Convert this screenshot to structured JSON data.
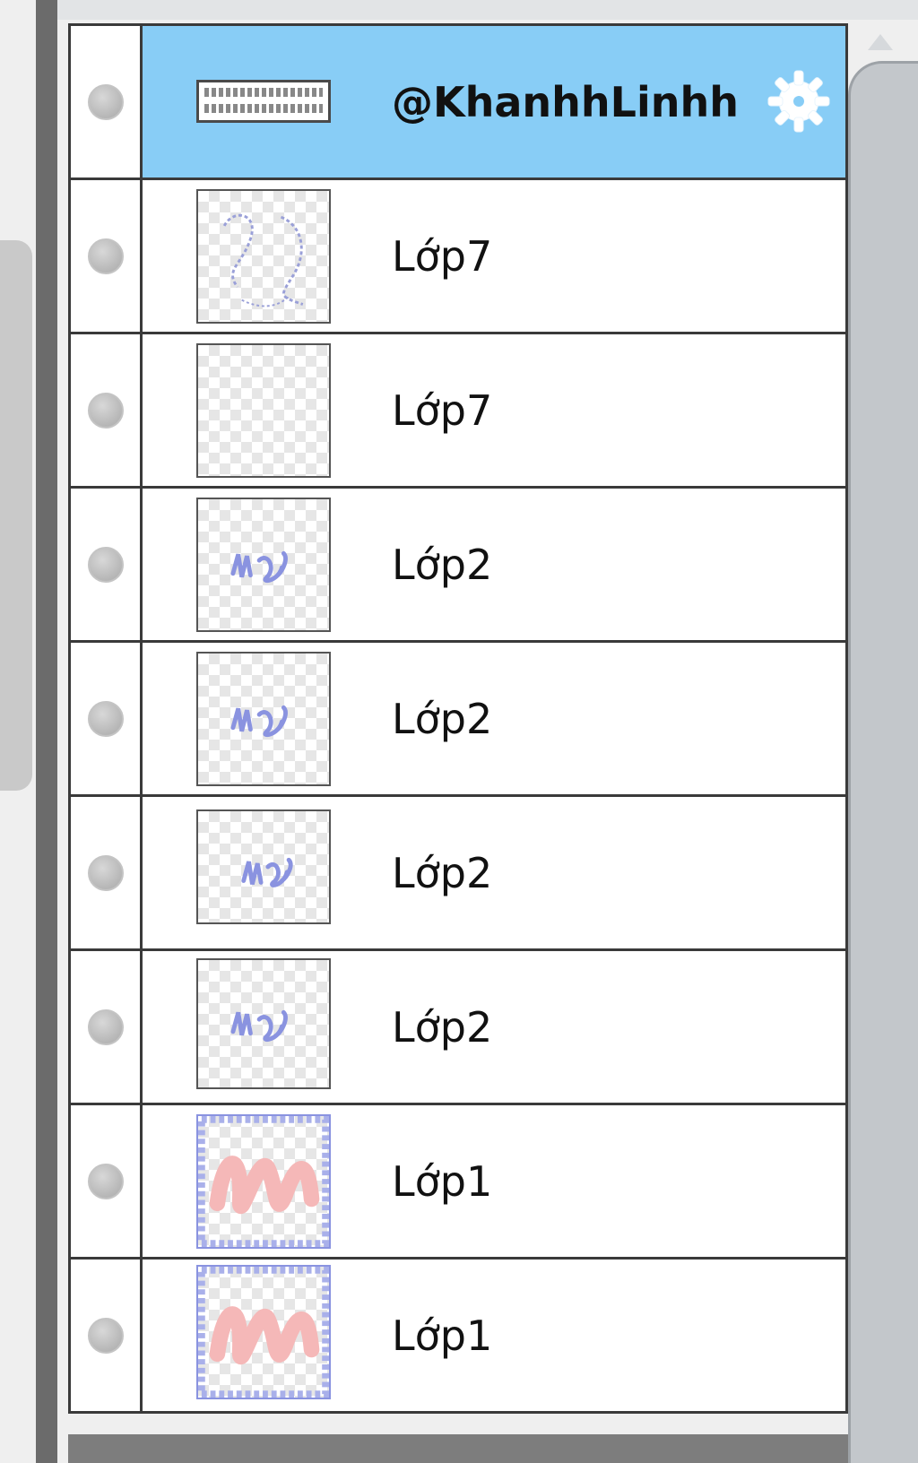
{
  "layers": [
    {
      "name": "@KhanhhLinhh",
      "selected": true,
      "thumb": "text",
      "visible_icon": "visibility-dot-icon"
    },
    {
      "name": "Lớp7",
      "selected": false,
      "thumb": "sketch"
    },
    {
      "name": "Lớp7",
      "selected": false,
      "thumb": "empty"
    },
    {
      "name": "Lớp2",
      "selected": false,
      "thumb": "signature"
    },
    {
      "name": "Lớp2",
      "selected": false,
      "thumb": "signature"
    },
    {
      "name": "Lớp2",
      "selected": false,
      "thumb": "signature"
    },
    {
      "name": "Lớp2",
      "selected": false,
      "thumb": "signature"
    },
    {
      "name": "Lớp1",
      "selected": false,
      "thumb": "pink-scribble"
    },
    {
      "name": "Lớp1",
      "selected": false,
      "thumb": "pink-scribble"
    }
  ],
  "colors": {
    "selected_row": "#88cdf6",
    "row_border": "#3a3a3a",
    "signature_ink": "#8a93e0",
    "scribble_pink": "#f5b8b8"
  },
  "icons": {
    "settings": "gear-icon",
    "visibility": "visibility-dot-icon"
  }
}
